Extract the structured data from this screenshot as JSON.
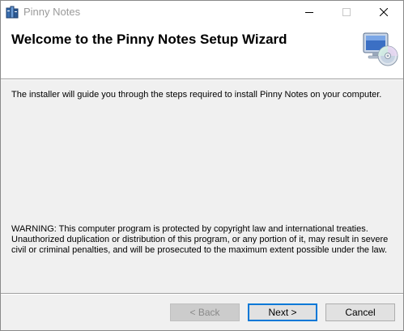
{
  "window": {
    "title": "Pinny Notes",
    "app_icon": "installer-package-icon",
    "controls": {
      "minimize_icon": "minimize-icon",
      "maximize_icon": "maximize-icon",
      "close_icon": "close-icon"
    }
  },
  "banner": {
    "title": "Welcome to the Pinny Notes Setup Wizard",
    "icon": "computer-cd-icon"
  },
  "body": {
    "intro": "The installer will guide you through the steps required to install Pinny Notes on your computer.",
    "warning": "WARNING: This computer program is protected by copyright law and international treaties. Unauthorized duplication or distribution of this program, or any portion of it, may result in severe civil or criminal penalties, and will be prosecuted to the maximum extent possible under the law."
  },
  "buttons": {
    "back": "< Back",
    "next": "Next >",
    "cancel": "Cancel"
  },
  "colors": {
    "accent": "#0078d7",
    "dialog_bg": "#f0f0f0",
    "banner_bg": "#ffffff"
  }
}
